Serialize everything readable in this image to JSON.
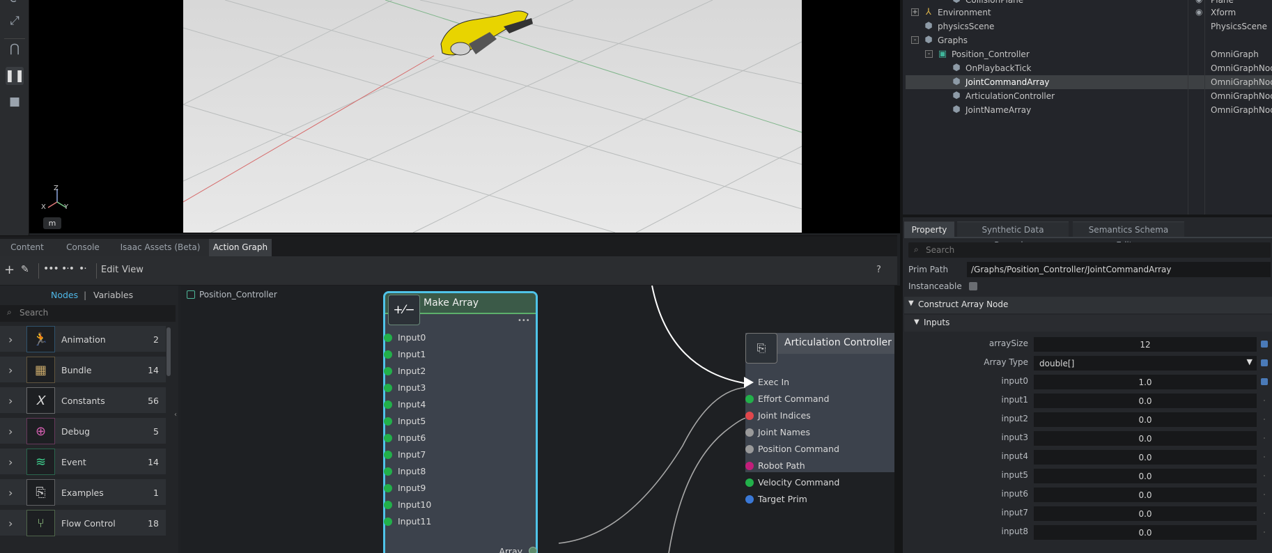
{
  "toolbar_icons": [
    "rotate-icon",
    "scale-icon",
    "snap-magnet-icon",
    "pause-icon",
    "stop-icon"
  ],
  "viewport": {
    "axis": {
      "z": "Z",
      "x": "X",
      "y": "Y"
    },
    "unit_label": "m"
  },
  "stage": {
    "rows": [
      {
        "name": "CollisionPlane",
        "type": "Plane",
        "indent": 3,
        "expander": "",
        "icon": "cube-icon",
        "visible": true
      },
      {
        "name": "Environment",
        "type": "Xform",
        "indent": 1,
        "expander": "+",
        "icon": "xform-icon",
        "visible": true
      },
      {
        "name": "physicsScene",
        "type": "PhysicsScene",
        "indent": 1,
        "expander": "",
        "icon": "cube-icon",
        "visible": false
      },
      {
        "name": "Graphs",
        "type": "",
        "indent": 1,
        "expander": "-",
        "icon": "cube-icon",
        "visible": false
      },
      {
        "name": "Position_Controller",
        "type": "OmniGraph",
        "indent": 2,
        "expander": "-",
        "icon": "graph-icon",
        "visible": false
      },
      {
        "name": "OnPlaybackTick",
        "type": "OmniGraphNode",
        "indent": 3,
        "expander": "",
        "icon": "cube-icon",
        "visible": false
      },
      {
        "name": "JointCommandArray",
        "type": "OmniGraphNode",
        "indent": 3,
        "expander": "",
        "icon": "cube-icon",
        "visible": false,
        "selected": true
      },
      {
        "name": "ArticulationController",
        "type": "OmniGraphNode",
        "indent": 3,
        "expander": "",
        "icon": "cube-icon",
        "visible": false
      },
      {
        "name": "JointNameArray",
        "type": "OmniGraphNode",
        "indent": 3,
        "expander": "",
        "icon": "cube-icon",
        "visible": false
      }
    ]
  },
  "property_panel": {
    "tabs": [
      "Property",
      "Synthetic Data Recorder",
      "Semantics Schema Editor"
    ],
    "active_tab": 0,
    "search_placeholder": "Search",
    "prim_path_label": "Prim Path",
    "prim_path_value": "/Graphs/Position_Controller/JointCommandArray",
    "instanceable_label": "Instanceable",
    "section_title": "Construct Array Node",
    "subsection_title": "Inputs",
    "fields": [
      {
        "label": "arraySize",
        "value": "12",
        "dot": true
      },
      {
        "label": "Array Type",
        "value": "double[]",
        "dot": true,
        "dropdown": true
      },
      {
        "label": "input0",
        "value": "1.0",
        "dot": true
      },
      {
        "label": "input1",
        "value": "0.0",
        "dot": false
      },
      {
        "label": "input2",
        "value": "0.0",
        "dot": false
      },
      {
        "label": "input3",
        "value": "0.0",
        "dot": false
      },
      {
        "label": "input4",
        "value": "0.0",
        "dot": false
      },
      {
        "label": "input5",
        "value": "0.0",
        "dot": false
      },
      {
        "label": "input6",
        "value": "0.0",
        "dot": false
      },
      {
        "label": "input7",
        "value": "0.0",
        "dot": false
      },
      {
        "label": "input8",
        "value": "0.0",
        "dot": false
      }
    ]
  },
  "bottom_tabs": [
    "Content",
    "Console",
    "Isaac Assets (Beta)",
    "Action Graph"
  ],
  "active_bottom_tab": 3,
  "action_graph_toolbar": {
    "edit_label": "Edit",
    "view_label": "View",
    "help_label": "?"
  },
  "library": {
    "tab_nodes": "Nodes",
    "tab_separator": "|",
    "tab_variables": "Variables",
    "search_placeholder": "Search",
    "categories": [
      {
        "name": "Animation",
        "count": "2",
        "icon": "running-figure-icon",
        "color": "#4aa3df"
      },
      {
        "name": "Bundle",
        "count": "14",
        "icon": "box-icon",
        "color": "#c8a86a"
      },
      {
        "name": "Constants",
        "count": "56",
        "icon": "x-variable-icon",
        "color": "#d9d9d9"
      },
      {
        "name": "Debug",
        "count": "5",
        "icon": "bug-magnifier-icon",
        "color": "#d45fb0"
      },
      {
        "name": "Event",
        "count": "14",
        "icon": "wifi-signal-icon",
        "color": "#3fcf8e"
      },
      {
        "name": "Examples",
        "count": "1",
        "icon": "graph-node-icon",
        "color": "#c9c9c9"
      },
      {
        "name": "Flow Control",
        "count": "18",
        "icon": "flow-tree-icon",
        "color": "#9ad08a"
      }
    ]
  },
  "graph": {
    "breadcrumb": "Position_Controller",
    "make_array": {
      "title": "Make Array",
      "inputs": [
        "Input0",
        "Input1",
        "Input2",
        "Input3",
        "Input4",
        "Input5",
        "Input6",
        "Input7",
        "Input8",
        "Input9",
        "Input10",
        "Input11"
      ],
      "output": "Array",
      "menu": "•••"
    },
    "articulation_controller": {
      "title": "Articulation Controller",
      "inputs": [
        {
          "label": "Exec In",
          "color": "#ffffff"
        },
        {
          "label": "Effort Command",
          "color": "#22b04a"
        },
        {
          "label": "Joint Indices",
          "color": "#e0474c"
        },
        {
          "label": "Joint Names",
          "color": "#9a9a9a"
        },
        {
          "label": "Position Command",
          "color": "#9a9a9a"
        },
        {
          "label": "Robot Path",
          "color": "#c21e7a"
        },
        {
          "label": "Velocity Command",
          "color": "#22b04a"
        },
        {
          "label": "Target Prim",
          "color": "#3a78d6"
        }
      ]
    }
  },
  "colors": {
    "accent_selected_node": "#4fc3e8",
    "node_header": "#3b5a48",
    "port_green": "#22b04a",
    "dot_blue": "#4a7ab8"
  }
}
